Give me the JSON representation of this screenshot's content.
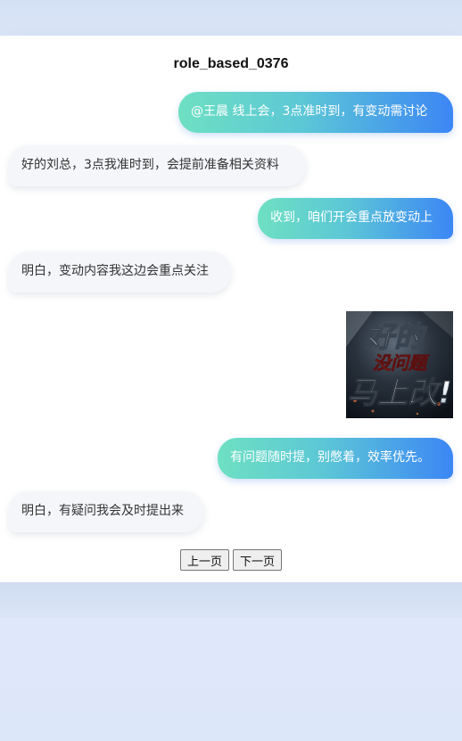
{
  "page": {
    "title": "role_based_0376"
  },
  "messages": [
    {
      "side": "sent",
      "text": "@王晨 线上会，3点准时到，有变动需讨论"
    },
    {
      "side": "received",
      "text": "好的刘总，3点我准时到，会提前准备相关资料"
    },
    {
      "side": "sent",
      "text": "收到，咱们开会重点放变动上"
    },
    {
      "side": "received",
      "text": "明白，变动内容我这边会重点关注"
    },
    {
      "side": "sent",
      "sticker": {
        "line1": "好的",
        "line2": "没问题",
        "line3": "马上改!"
      }
    },
    {
      "side": "sent",
      "text": "有问题随时提，别憋着，效率优先。"
    },
    {
      "side": "received",
      "text": "明白，有疑问我会及时提出来"
    }
  ],
  "pager": {
    "prev_label": "上一页",
    "next_label": "下一页"
  },
  "colors": {
    "sent_gradient_start": "#6ee0c2",
    "sent_gradient_end": "#3c86f5",
    "received_bg": "#f4f6fa"
  }
}
